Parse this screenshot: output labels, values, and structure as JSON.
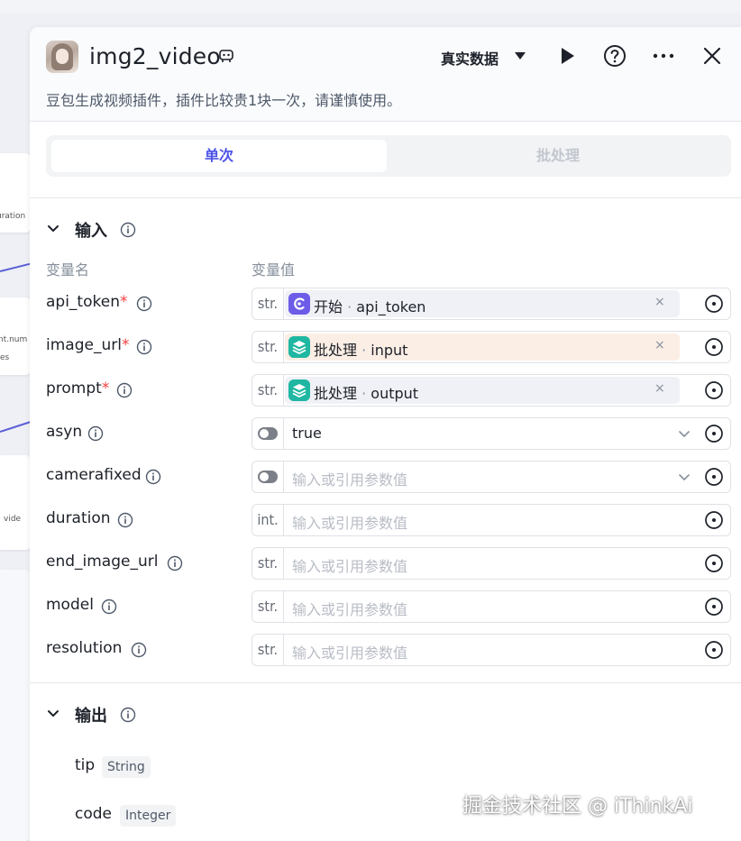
{
  "canvas": {
    "node_fragments": [
      "uration",
      "nt.num",
      "es",
      "vide"
    ]
  },
  "header": {
    "title": "img2_video",
    "mode_label": "真实数据",
    "description": "豆包生成视频插件，插件比较贵1块一次，请谨慎使用。",
    "icons": [
      "run-icon",
      "help-icon",
      "more-icon",
      "close-icon"
    ]
  },
  "tabs": [
    {
      "label": "单次",
      "active": true
    },
    {
      "label": "批处理",
      "active": false
    }
  ],
  "input_section": {
    "title": "输入",
    "col_name": "变量名",
    "col_value": "变量值",
    "params": [
      {
        "name": "api_token",
        "required_mark": "*",
        "type": "str.",
        "ref_node": "开始",
        "ref_sep": " · ",
        "ref_var": "api_token",
        "clear": "×"
      },
      {
        "name": "image_url",
        "required_mark": "*",
        "type": "str.",
        "ref_node": "批处理",
        "ref_sep": " · ",
        "ref_var": "input",
        "clear": "×"
      },
      {
        "name": "prompt",
        "required_mark": "*",
        "type": "str.",
        "ref_node": "批处理",
        "ref_sep": " · ",
        "ref_var": "output",
        "clear": "×"
      },
      {
        "name": "asyn",
        "value": "true"
      },
      {
        "name": "camerafixed",
        "placeholder": "输入或引用参数值"
      },
      {
        "name": "duration",
        "type": "int.",
        "placeholder": "输入或引用参数值"
      },
      {
        "name": "end_image_url",
        "type": "str.",
        "placeholder": "输入或引用参数值"
      },
      {
        "name": "model",
        "type": "str.",
        "placeholder": "输入或引用参数值"
      },
      {
        "name": "resolution",
        "type": "str.",
        "placeholder": "输入或引用参数值"
      }
    ]
  },
  "output_section": {
    "title": "输出",
    "fields": [
      {
        "name": "tip",
        "type": "String"
      },
      {
        "name": "code",
        "type": "Integer"
      }
    ]
  },
  "watermark": "掘金技术社区 @ iThinkAi",
  "colors": {
    "accent": "#4d53e8",
    "required": "#f53f3f",
    "start_node": "#6d5ce8",
    "batch_node": "#1fb7a2"
  }
}
